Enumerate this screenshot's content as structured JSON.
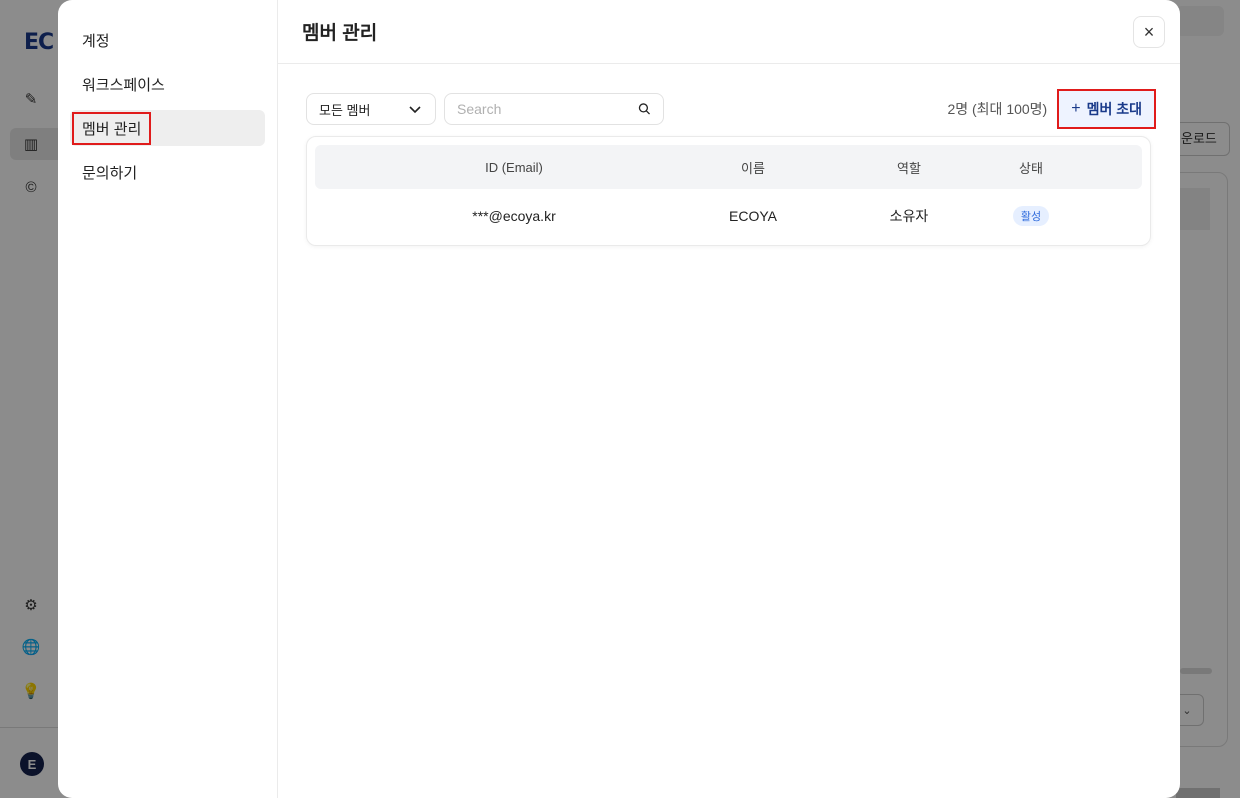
{
  "background": {
    "logo": "EC",
    "download_label": "운로드",
    "avatar_letter": "E"
  },
  "nav": {
    "items": [
      {
        "label": "계정"
      },
      {
        "label": "워크스페이스"
      },
      {
        "label": "멤버 관리"
      },
      {
        "label": "문의하기"
      }
    ]
  },
  "header": {
    "title": "멤버 관리",
    "close": "×"
  },
  "toolbar": {
    "filter_value": "모든 멤버",
    "search_placeholder": "Search",
    "count_text": "2명 (최대 100명)",
    "invite_plus": "+",
    "invite_label": "멤버 초대"
  },
  "table": {
    "headers": {
      "email": "ID (Email)",
      "name": "이름",
      "role": "역할",
      "status": "상태"
    },
    "rows": [
      {
        "email": "***@ecoya.kr",
        "name": "ECOYA",
        "role": "소유자",
        "status": "활성"
      }
    ]
  },
  "colors": {
    "highlight": "#e01b1b",
    "brand": "#1a3a8a",
    "badge_bg": "#e6efff",
    "badge_text": "#2f6bdc"
  }
}
